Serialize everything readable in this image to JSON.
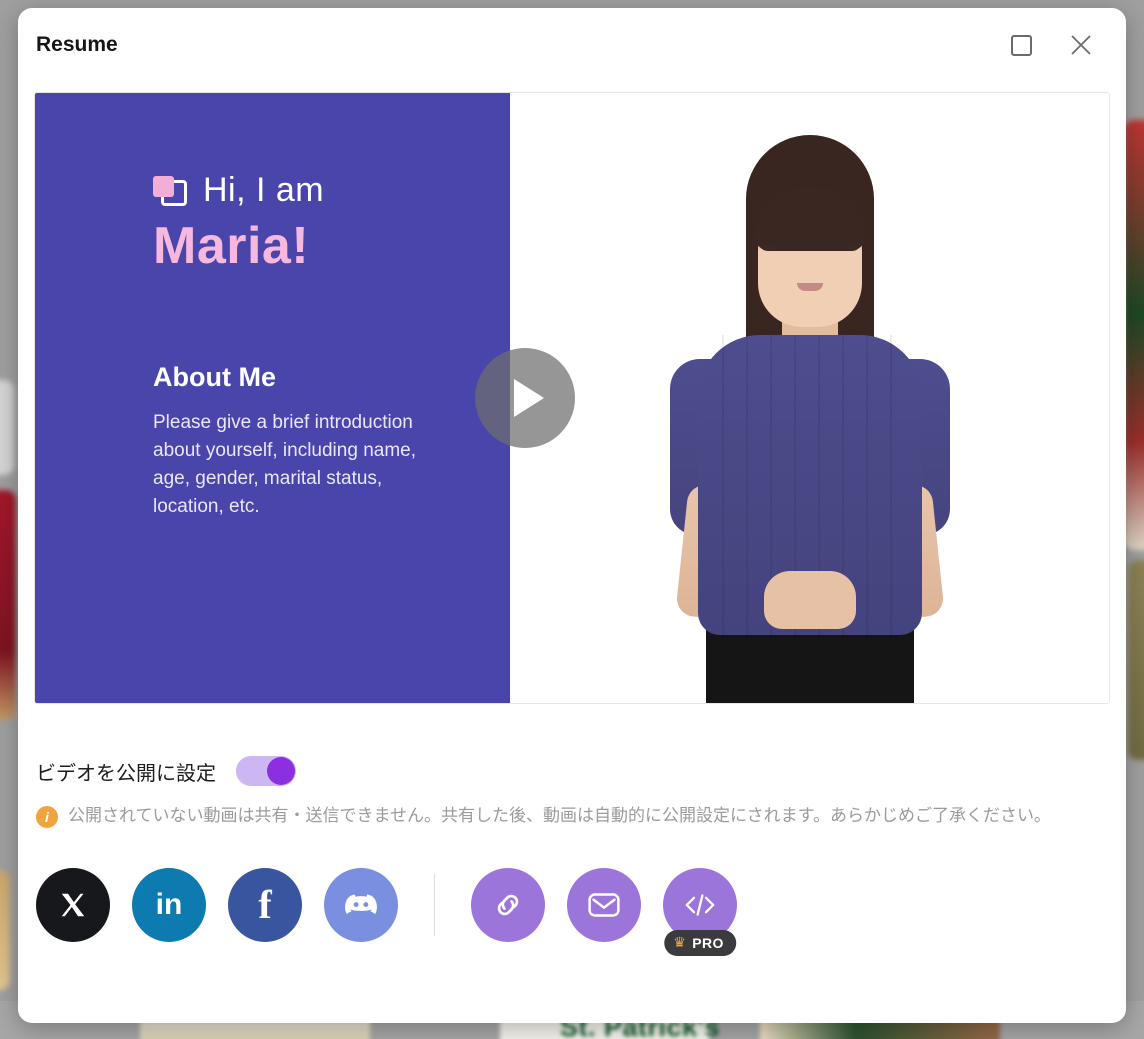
{
  "modal": {
    "title": "Resume",
    "controls": {
      "maximize_label": "Maximize",
      "close_label": "Close",
      "close_glyph": "✕"
    }
  },
  "video": {
    "slide": {
      "greeting": "Hi, I am",
      "name": "Maria!",
      "about_heading": "About Me",
      "about_body": "Please give a brief introduction about yourself, including name, age, gender, marital status, location, etc.",
      "background_color": "#4a45ab",
      "name_color": "#f6b9dd"
    },
    "play_button_label": "Play"
  },
  "settings": {
    "public_toggle_label": "ビデオを公開に設定",
    "public_toggle_state": "on",
    "toggle_accent_color": "#8b2fe0",
    "notice": "公開されていない動画は共有・送信できません。共有した後、動画は自動的に公開設定にされます。あらかじめご了承ください。",
    "notice_icon": "info-icon",
    "notice_icon_glyph": "i",
    "notice_icon_color": "#f0a43c"
  },
  "share": {
    "socials": [
      {
        "name": "x-twitter",
        "label": "X",
        "glyph": "𝕏",
        "color": "#17181c"
      },
      {
        "name": "linkedin",
        "label": "LinkedIn",
        "glyph": "in",
        "color": "#0d7ab0"
      },
      {
        "name": "facebook",
        "label": "Facebook",
        "glyph": "f",
        "color": "#3a559f"
      },
      {
        "name": "discord",
        "label": "Discord",
        "glyph": "●●",
        "color": "#7b8fe0"
      }
    ],
    "actions": [
      {
        "name": "copy-link",
        "label": "Copy link",
        "glyph": "🔗",
        "color": "#9b75d9"
      },
      {
        "name": "send-email",
        "label": "Send email",
        "glyph": "✉",
        "color": "#9b75d9"
      },
      {
        "name": "embed-code",
        "label": "Embed code",
        "glyph": "</>",
        "color": "#9b75d9"
      }
    ],
    "pro_badge": {
      "text": "PRO",
      "crown_glyph": "♛",
      "crown_color": "#f2ad35"
    }
  },
  "background": {
    "page_title_behind": "St. Patrick's"
  }
}
